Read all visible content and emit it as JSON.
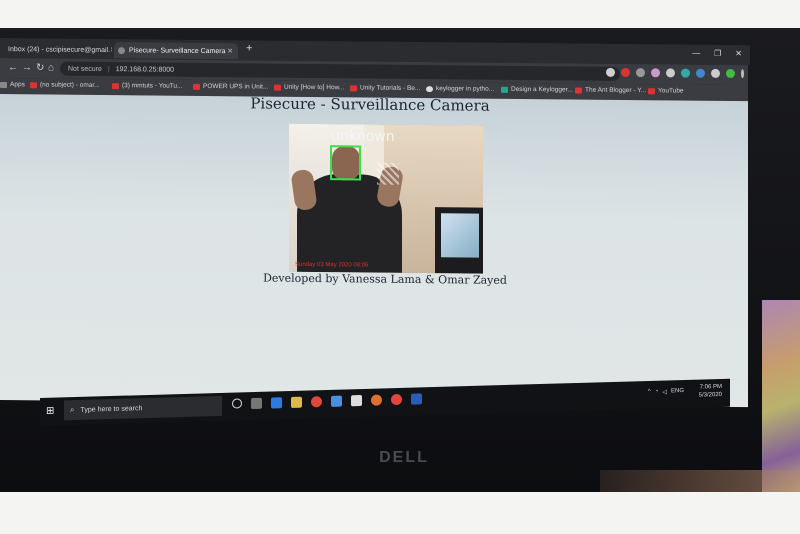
{
  "browser": {
    "tabs": [
      {
        "label": "Inbox (24) - cscipisecure@gmail.",
        "active": false
      },
      {
        "label": "Pisecure- Surveillance Camera",
        "active": true
      }
    ],
    "new_tab": "+",
    "window_controls": [
      "—",
      "❐",
      "✕"
    ],
    "nav": {
      "back": "←",
      "forward": "→",
      "reload": "↻",
      "home": "⌂"
    },
    "address": {
      "security": "Not secure",
      "separator": "|",
      "url": "192.168.0.25:8000"
    },
    "bookmarks": [
      {
        "label": "Apps",
        "icon": "apps-grid-icon"
      },
      {
        "label": "(no subject) - omar...",
        "icon": "gmail-icon"
      },
      {
        "label": "(3) mmtuts - YouTu...",
        "icon": "youtube-icon"
      },
      {
        "label": "POWER UPS in Unit...",
        "icon": "youtube-icon"
      },
      {
        "label": "Unity [How to] How...",
        "icon": "youtube-icon"
      },
      {
        "label": "Unity Tutorials - Be...",
        "icon": "youtube-icon"
      },
      {
        "label": "keylogger in pytho...",
        "icon": "google-icon"
      },
      {
        "label": "Design a Keylogger...",
        "icon": "geeksforgeeks-icon"
      },
      {
        "label": "The Ant Blogger - Y...",
        "icon": "youtube-icon"
      },
      {
        "label": "YouTube",
        "icon": "youtube-icon"
      }
    ]
  },
  "page": {
    "title": "Pisecure - Surveillance Camera",
    "camera": {
      "detection_label": "unknown",
      "timestamp": "Sunday 03 May 2020 08:06"
    },
    "caption": "Developed by Vanessa Lama & Omar Zayed"
  },
  "taskbar": {
    "search_placeholder": "Type here to search",
    "tray_lang": "ENG",
    "time": "7:06 PM",
    "date": "5/3/2020"
  },
  "monitor": {
    "brand": "DELL"
  },
  "colors": {
    "detection_box": "#3ee04a",
    "timestamp": "#e03030"
  }
}
